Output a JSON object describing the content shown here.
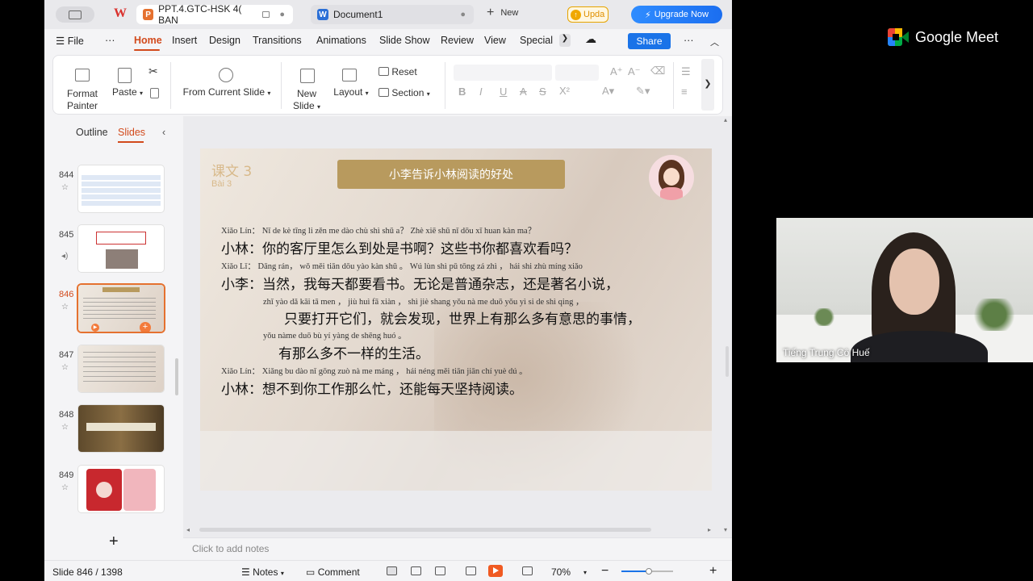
{
  "tabs": {
    "tab1_label": "PPT.4.GTC-HSK 4( BAN",
    "tab2_label": "Document1",
    "new_label": "New",
    "update_label": "Upda",
    "upgrade_label": "Upgrade Now"
  },
  "menu": {
    "file": "File",
    "more": "···",
    "items": [
      "Home",
      "Insert",
      "Design",
      "Transitions",
      "Animations",
      "Slide Show",
      "Review",
      "View",
      "Special F"
    ],
    "share": "Share"
  },
  "ribbon": {
    "format_painter": "Format Painter",
    "paste": "Paste",
    "from_current": "From Current Slide",
    "new_slide": "New Slide",
    "layout": "Layout",
    "reset": "Reset",
    "section": "Section"
  },
  "left_pane": {
    "outline_tab": "Outline",
    "slides_tab": "Slides",
    "slide_numbers": [
      "844",
      "845",
      "846",
      "847",
      "848",
      "849"
    ],
    "selected": "846"
  },
  "slide": {
    "lesson": "课文 3",
    "lesson_sub": "Bài 3",
    "title": "小李告诉小林阅读的好处",
    "lines": [
      {
        "pinyin": "Xiǎo Lín：  Nǐ de kè tīng li zěn me dào chù shì shū a？  Zhè xiē shū nǐ dōu xǐ huan kàn ma？",
        "hanzi": "小林：你的客厅里怎么到处是书啊？这些书你都喜欢看吗？"
      },
      {
        "pinyin": "Xiǎo Lǐ：   Dāng rán，  wǒ měi tiān dōu yào kàn shū 。 Wú lùn shì pǔ tōng zá zhì ，  hái shi zhù míng xiǎo",
        "hanzi": "小李：当然，我每天都要看书。无论是普通杂志，还是著名小说，"
      },
      {
        "pinyin": "zhǐ yào dǎ kāi tā men ，  jiù huì fā xiàn ，  shì jiè shang yǒu nà me duō yǒu yì si de shì qing ，",
        "hanzi": "只要打开它们，就会发现，世界上有那么多有意思的事情，"
      },
      {
        "pinyin": "yǒu nàme duō bù yí yàng de shēng huó 。",
        "hanzi": "有那么多不一样的生活。"
      },
      {
        "pinyin": "Xiǎo Lín：  Xiǎng bu dào nǐ gōng zuò nà me máng ，  hái néng měi tiān jiān chí yuè dú 。",
        "hanzi": "小林：想不到你工作那么忙，还能每天坚持阅读。"
      }
    ]
  },
  "notes_placeholder": "Click to add notes",
  "status": {
    "slide_info": "Slide 846 / 1398",
    "notes": "Notes",
    "comment": "Comment",
    "zoom": "70%",
    "zoom_fraction": 0.53
  },
  "meet": {
    "brand": "Google Meet",
    "participant": "Tiếng Trung Cô Huế"
  }
}
